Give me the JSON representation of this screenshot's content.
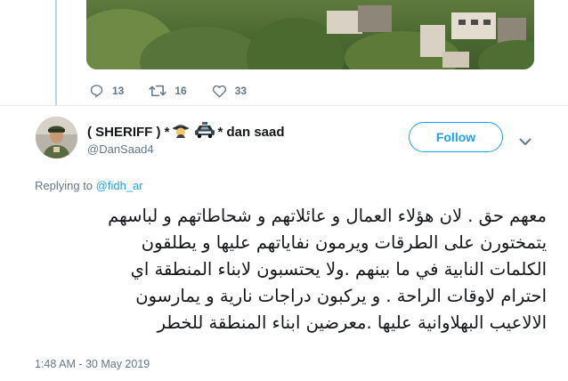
{
  "previous_tweet": {
    "replies": "13",
    "retweets": "16",
    "likes": "33",
    "icons": {
      "reply": "reply-icon",
      "retweet": "retweet-icon",
      "like": "heart-icon"
    }
  },
  "tweet": {
    "display_name": "( SHERIFF ) *",
    "display_name_suffix": "* dan saad",
    "emojis": [
      "detective-emoji",
      "police-car-emoji"
    ],
    "handle": "@DanSaad4",
    "follow_label": "Follow",
    "replying_prefix": "Replying to",
    "replying_to": "@fidh_ar",
    "text_lines": [
      "معهم حق . لان هؤلاء العمال و عائلاتهم و شحاطاتهم و لباسهم",
      "يتمختورن على الطرقات ويرمون نفاياتهم عليها و يطلقون",
      "الكلمات النابية في ما بينهم .ولا يحتسبون لابناء المنطقة اي",
      "احترام لاوقات الراحة . و يركبون دراجات نارية و يمارسون",
      "الالاعيب البهلاوانية عليها .معرضين ابناء المنطقة للخطر"
    ],
    "timestamp": "1:48 AM - 30 May 2019"
  },
  "colors": {
    "accent": "#1da1f2",
    "secondary_text": "#657786",
    "thread_line": "#b3d8f5",
    "divider": "#e6ecf0"
  }
}
